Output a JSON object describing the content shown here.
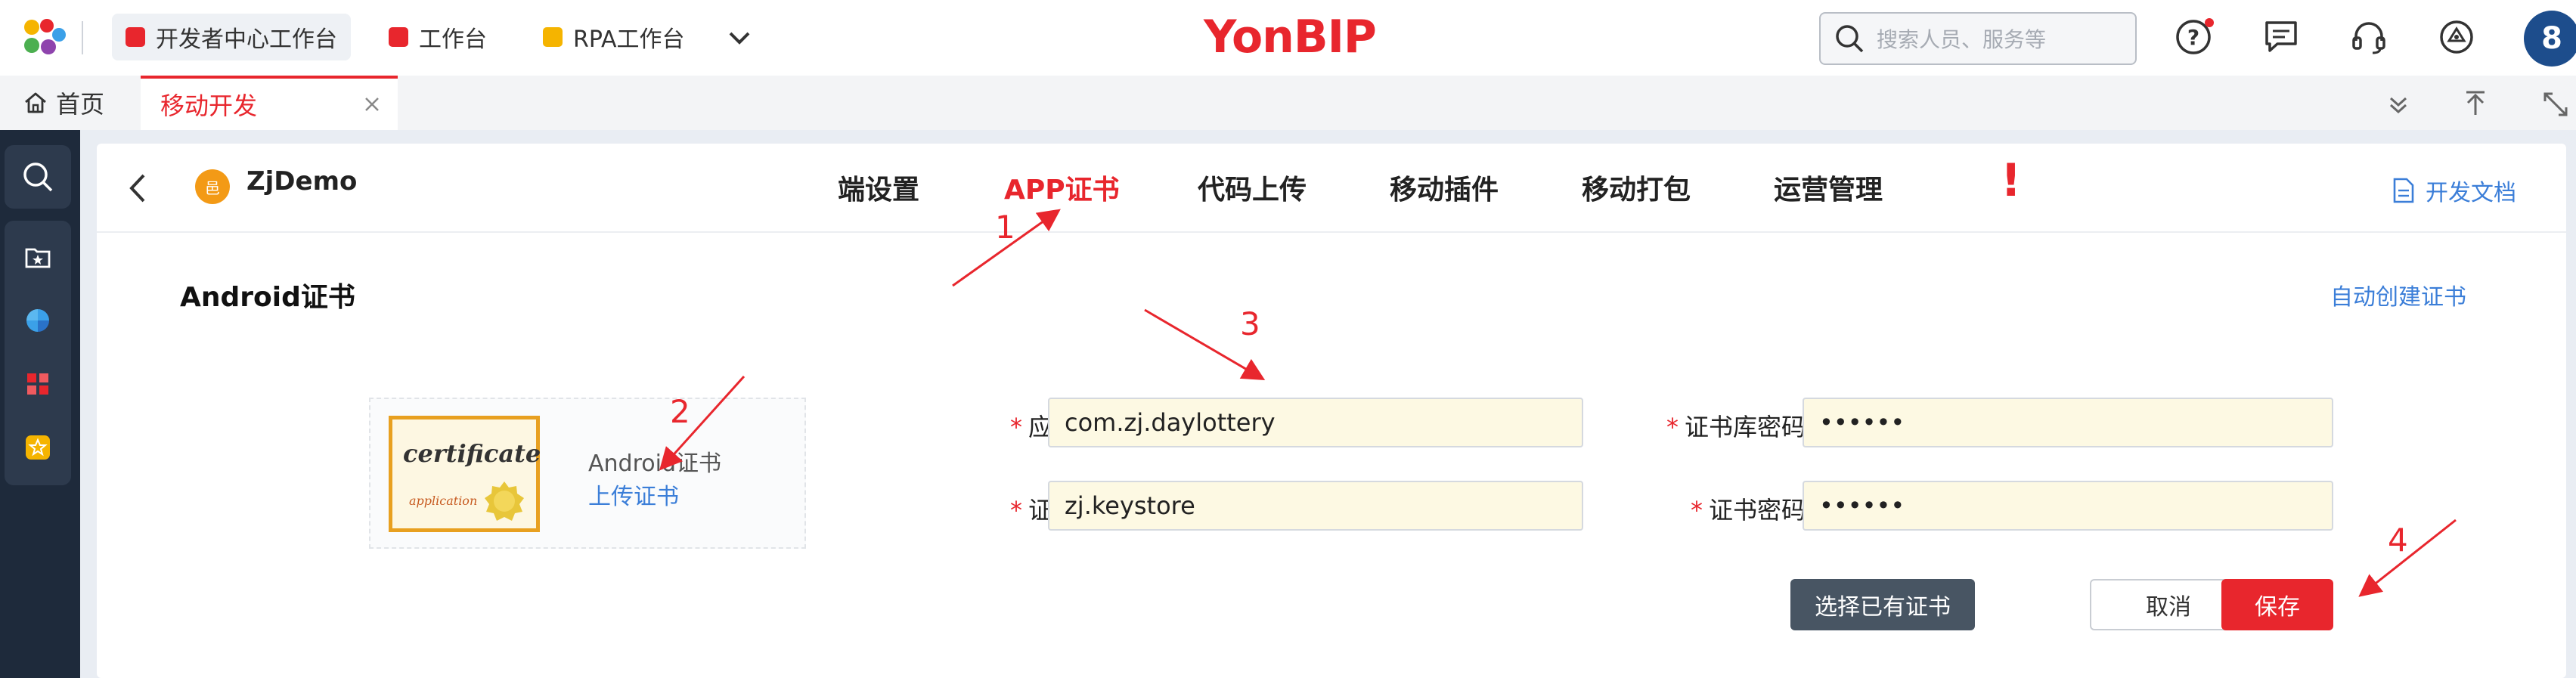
{
  "topbar": {
    "tabs": [
      {
        "label": "开发者中心工作台",
        "color": "#e8262d"
      },
      {
        "label": "工作台",
        "color": "#e8262d"
      },
      {
        "label": "RPA工作台",
        "color": "#f5b400"
      }
    ],
    "brand": "YonBIP",
    "search_placeholder": "搜索人员、服务等",
    "avatar": "8",
    "icons": [
      "help-icon",
      "message-icon",
      "headset-icon",
      "assistant-icon"
    ]
  },
  "tabbar": {
    "home": "首页",
    "active_tab": "移动开发"
  },
  "app": {
    "icon_text": "邑",
    "name": "ZjDemo",
    "nav": [
      "端设置",
      "APP证书",
      "代码上传",
      "移动插件",
      "移动打包",
      "运营管理"
    ],
    "active_nav": "APP证书",
    "doc_link": "开发文档"
  },
  "section": {
    "title": "Android证书",
    "auto_create": "自动创建证书"
  },
  "certificate": {
    "image_title": "certificate",
    "image_sub": "application",
    "name": "Android证书",
    "upload": "上传证书"
  },
  "form": {
    "package_label": "应用包名",
    "package_value": "com.zj.daylottery",
    "store_password_label": "证书库密码",
    "store_password_value": "••••••",
    "alias_label": "证书别名",
    "alias_value": "zj.keystore",
    "cert_password_label": "证书密码",
    "cert_password_value": "••••••",
    "required_mark": "*"
  },
  "buttons": {
    "choose_existing": "选择已有证书",
    "cancel": "取消",
    "save": "保存"
  },
  "annotations": {
    "a1": "1",
    "a2": "2",
    "a3": "3",
    "a4": "4",
    "exclaim": "!"
  },
  "colors": {
    "accent_red": "#e8262d",
    "link_blue": "#3b7ed8",
    "dark_button": "#485563",
    "rail": "#1e2a3b"
  }
}
